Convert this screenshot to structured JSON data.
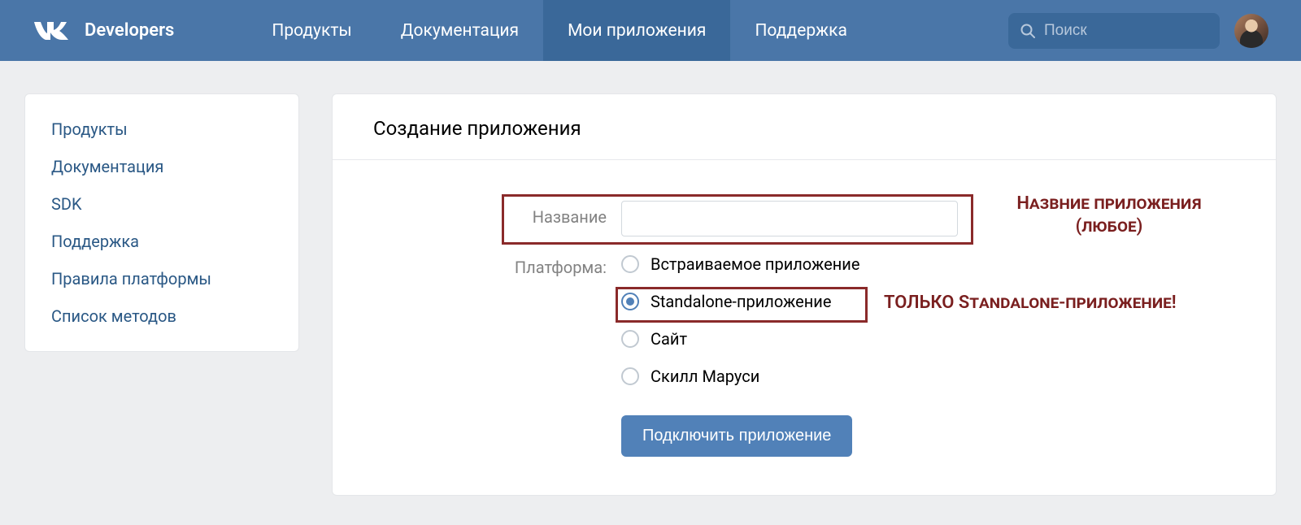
{
  "header": {
    "brand": "Developers",
    "nav": [
      "Продукты",
      "Документация",
      "Мои приложения",
      "Поддержка"
    ],
    "active_nav_index": 2,
    "search_placeholder": "Поиск"
  },
  "sidebar": {
    "items": [
      "Продукты",
      "Документация",
      "SDK",
      "Поддержка",
      "Правила платформы",
      "Список методов"
    ]
  },
  "main": {
    "title": "Создание приложения",
    "name_label": "Название",
    "name_value": "",
    "platform_label": "Платформа:",
    "platforms": [
      {
        "label": "Встраиваемое приложение",
        "checked": false
      },
      {
        "label": "Standalone-приложение",
        "checked": true
      },
      {
        "label": "Сайт",
        "checked": false
      },
      {
        "label": "Скилл Маруси",
        "checked": false
      }
    ],
    "submit_label": "Подключить приложение"
  },
  "annotations": {
    "name_hint_line1": "Назвние приложения",
    "name_hint_line2": "(любое)",
    "standalone_hint": "ТОЛЬКО Standalone-приложение!",
    "colors": {
      "box": "#8a2a2a",
      "text": "#7a1f1f"
    }
  }
}
